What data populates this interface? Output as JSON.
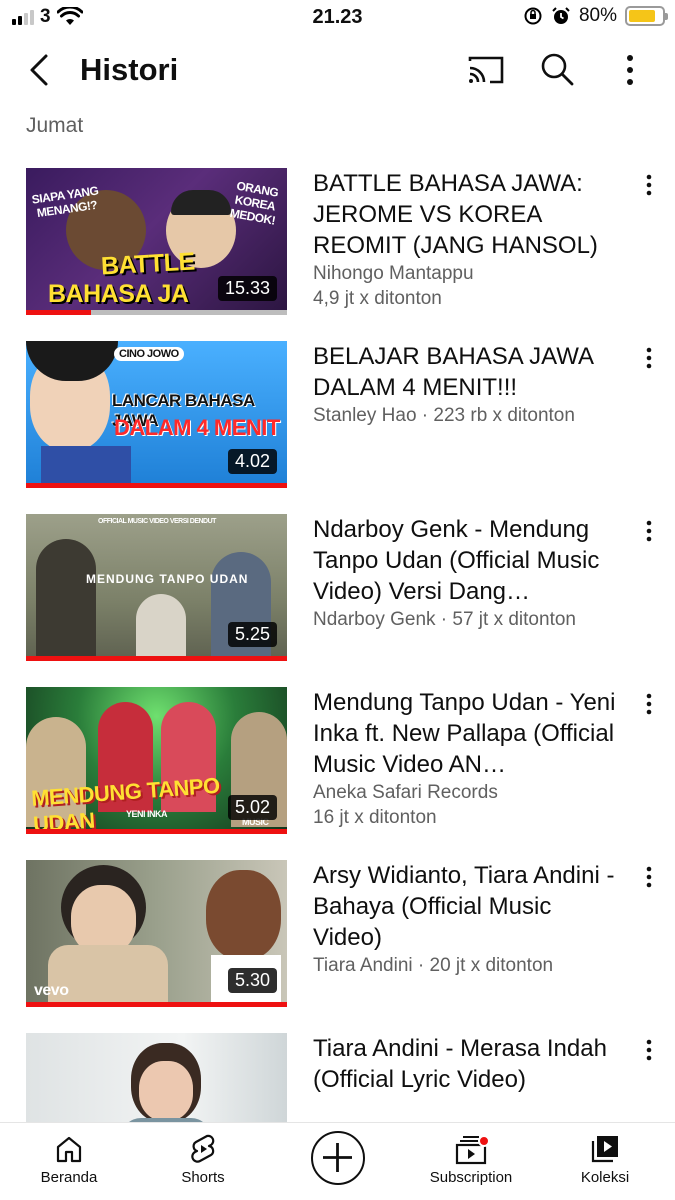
{
  "status_bar": {
    "carrier": "3",
    "time": "21.23",
    "battery": "80%",
    "battery_level": 0.8,
    "icons": [
      "signal-icon",
      "wifi-icon",
      "orientation-lock-icon",
      "alarm-icon",
      "battery-icon"
    ]
  },
  "header": {
    "title": "Histori",
    "icons": [
      "back-arrow-icon",
      "cast-icon",
      "search-icon",
      "more-vert-icon"
    ]
  },
  "section": {
    "label": "Jumat"
  },
  "videos": [
    {
      "title": "BATTLE BAHASA JAWA: JEROME VS KOREA REOMIT (JANG HANSOL)",
      "channel": "Nihongo Mantappu",
      "views": "4,9 jt x ditonton",
      "duration": "15.33",
      "thumb_text_1": "SIAPA YANG MENANG!?",
      "thumb_text_2": "ORANG KOREA MEDOK!",
      "thumb_text_3": "BATTLE",
      "thumb_text_4": "BAHASA JA",
      "watched": 0.25
    },
    {
      "title": "BELAJAR BAHASA JAWA DALAM 4 MENIT!!!",
      "meta": "Stanley Hao · 223 rb x ditonton",
      "duration": "4.02",
      "thumb_text_1": "CINO JOWO",
      "thumb_text_2": "LANCAR BAHASA JAWA",
      "thumb_text_3": "DALAM 4 MENIT",
      "watched": 1.0
    },
    {
      "title": "Ndarboy Genk - Mendung Tanpo Udan (Official Music Video) Versi Dang…",
      "meta": "Ndarboy Genk · 57 jt x ditonton",
      "duration": "5.25",
      "thumb_text_1": "OFFICIAL MUSIC VIDEO VERSI DENDUT",
      "thumb_text_2": "MENDUNG TANPO UDAN",
      "watched": 1.0
    },
    {
      "title": "Mendung Tanpo Udan - Yeni Inka ft. New Pallapa (Official Music Video AN…",
      "channel": "Aneka Safari Records",
      "views": "16 jt x ditonton",
      "duration": "5.02",
      "thumb_text_1": "MENDUNG TANPO UDAN",
      "thumb_text_2": "YENI INKA",
      "thumb_text_3": "MUSIC",
      "watched": 1.0
    },
    {
      "title": "Arsy Widianto, Tiara Andini - Bahaya (Official Music Video)",
      "meta": "Tiara Andini · 20 jt x ditonton",
      "duration": "5.30",
      "thumb_text_1": "vevo",
      "watched": 1.0
    },
    {
      "title": "Tiara Andini - Merasa Indah (Official Lyric Video)",
      "watched": 0
    }
  ],
  "bottom_nav": {
    "home": "Beranda",
    "shorts": "Shorts",
    "subscription": "Subscription",
    "library": "Koleksi"
  }
}
